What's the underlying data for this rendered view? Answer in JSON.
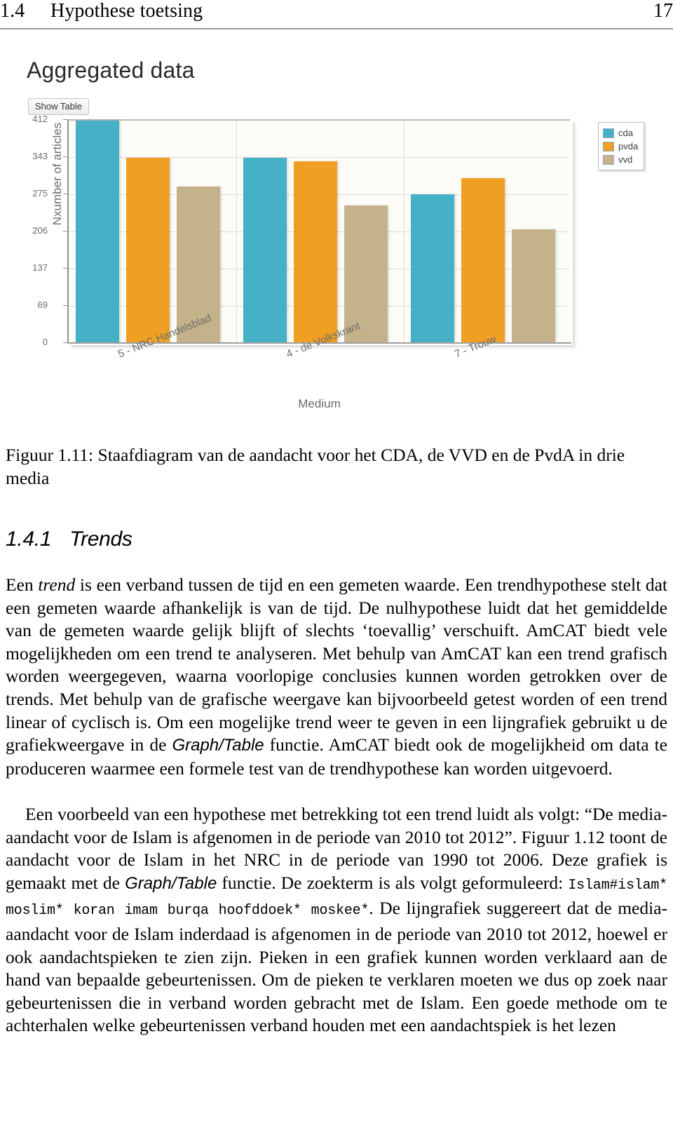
{
  "header": {
    "section_number": "1.4",
    "section_title": "Hypothese toetsing",
    "page_number": "17"
  },
  "figure": {
    "chart": {
      "title": "Aggregated data",
      "show_table_button": "Show Table",
      "y_axis_title": "Nxumber of articles",
      "x_axis_title": "Medium",
      "y_ticks": [
        "412",
        "343",
        "275",
        "206",
        "137",
        "69",
        "0"
      ],
      "legend": [
        {
          "label": "cda",
          "color": "#45b0c6"
        },
        {
          "label": "pvda",
          "color": "#efa024"
        },
        {
          "label": "vvd",
          "color": "#c4b38a"
        }
      ]
    },
    "caption": "Figuur 1.11: Staafdiagram van de aandacht voor het CDA, de VVD en de PvdA in drie media"
  },
  "chart_data": {
    "type": "bar",
    "title": "Aggregated data",
    "xlabel": "Medium",
    "ylabel": "Nxumber of articles",
    "ylim": [
      0,
      412
    ],
    "yticks": [
      0,
      69,
      137,
      206,
      275,
      343,
      412
    ],
    "grid": true,
    "legend_position": "right",
    "categories": [
      "5 - NRC Handelsblad",
      "4 - de Volkskrant",
      "7 - Trouw"
    ],
    "series": [
      {
        "name": "cda",
        "color": "#45b0c6",
        "values": [
          412,
          343,
          275
        ]
      },
      {
        "name": "pvda",
        "color": "#efa024",
        "values": [
          343,
          337,
          305
        ]
      },
      {
        "name": "vvd",
        "color": "#c4b38a",
        "values": [
          290,
          255,
          210
        ]
      }
    ]
  },
  "section": {
    "number": "1.4.1",
    "title": "Trends"
  },
  "paragraphs": {
    "p1_a": "Een ",
    "p1_trend": "trend",
    "p1_b": " is een verband tussen de tijd en een gemeten waarde. Een trendhypothese stelt dat een gemeten waarde afhankelijk is van de tijd. De nulhypothese luidt dat het gemiddelde van de gemeten waarde gelijk blijft of slechts ‘toevallig’ verschuift. AmCAT biedt vele mogelijkheden om een trend te analyseren. Met behulp van AmCAT kan een trend grafisch worden weergegeven, waarna voorlopige conclusies kunnen worden getrokken over de trends. Met behulp van de grafische weergave kan bijvoorbeeld getest worden of een trend linear of cyclisch is. Om een mogelijke trend weer te geven in een lijngrafiek gebruikt u de grafiekweergave in de ",
    "p1_graphtable": "Graph/Table",
    "p1_c": " functie. AmCAT biedt ook de mogelijkheid om data te produceren waarmee een formele test van de trendhypothese kan worden uitgevoerd.",
    "p2_a": "Een voorbeeld van een hypothese met betrekking tot een trend luidt als volgt: “De media-aandacht voor de Islam is afgenomen in de periode van 2010 tot 2012”. Figuur 1.12 toont de aandacht voor de Islam in het NRC in de periode van 1990 tot 2006. Deze grafiek is gemaakt met de ",
    "p2_graphtable": "Graph/Table",
    "p2_b": " functie. De zoekterm is als volgt geformuleerd: ",
    "p2_query": "Islam#islam* moslim* koran imam burqa hoofddoek* moskee*",
    "p2_c": ". De lijngrafiek suggereert dat de media-aandacht voor de Islam inderdaad is afgenomen in de periode van 2010 tot 2012, hoewel er ook aandachtspieken te zien zijn. Pieken in een grafiek kunnen worden verklaard aan de hand van bepaalde gebeurtenissen. Om de pieken te verklaren moeten we dus op zoek naar gebeurtenissen die in verband worden gebracht met de Islam. Een goede methode om te achterhalen welke gebeurtenissen verband houden met een aandachtspiek is het lezen"
  }
}
